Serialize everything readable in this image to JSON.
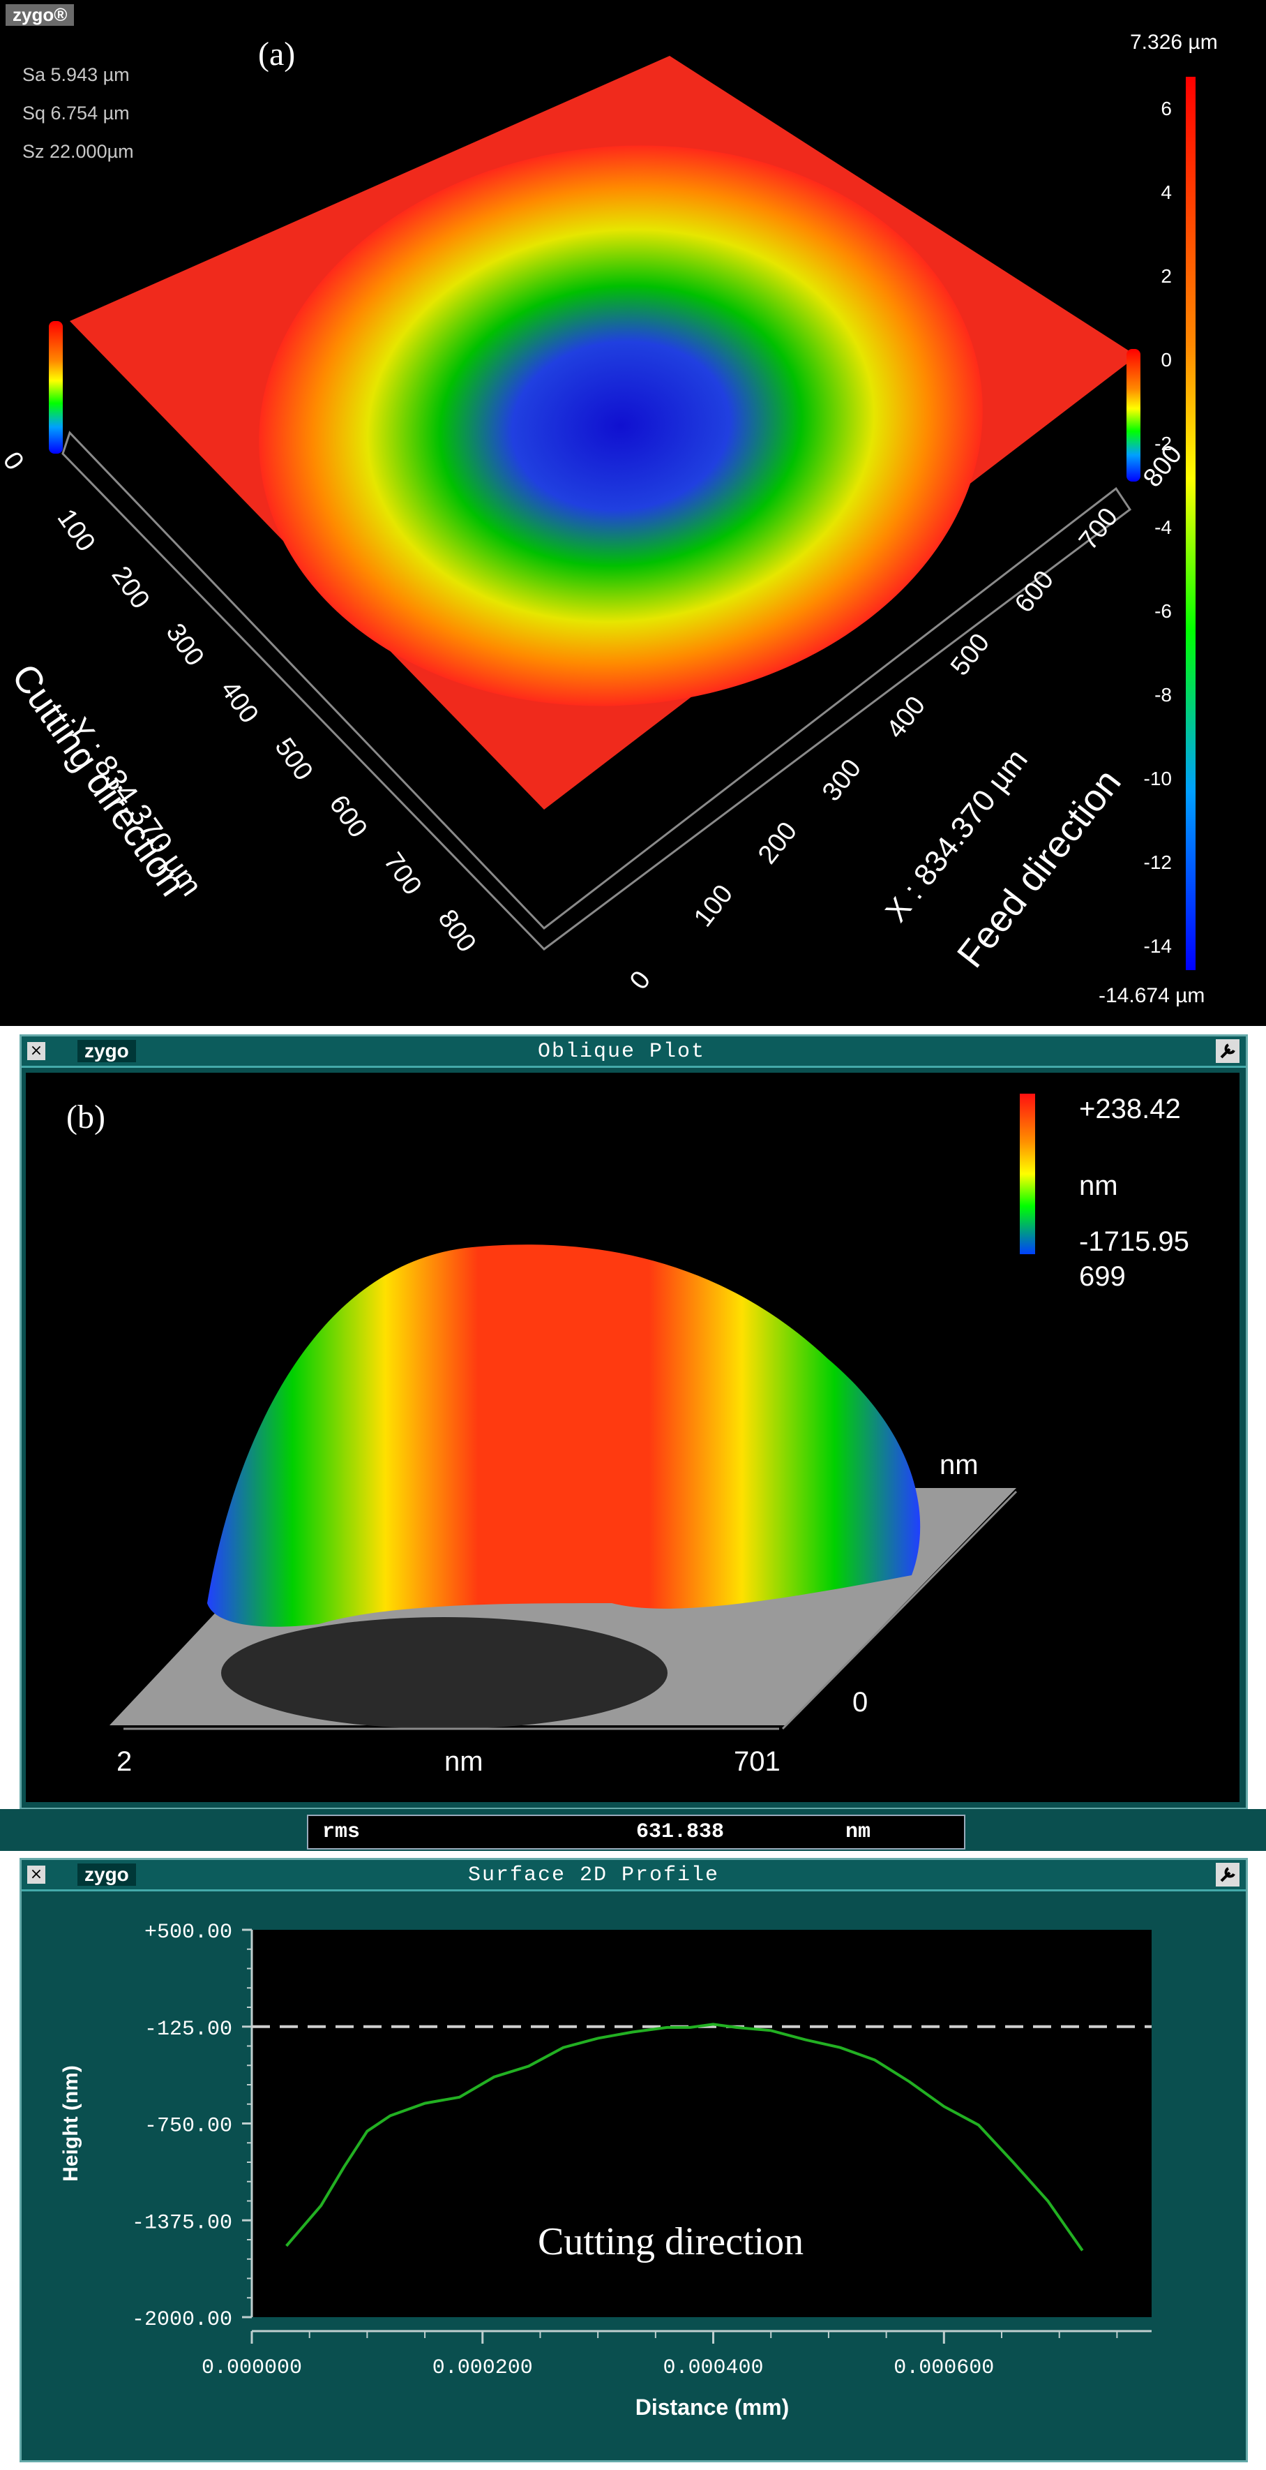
{
  "panel_a": {
    "brand": "zygo®",
    "label": "(a)",
    "stats": [
      "Sa 5.943   µm",
      "Sq 6.754   µm",
      "Sz 22.000µm"
    ],
    "colorbar": {
      "max_label": "7.326   µm",
      "min_label": "-14.674   µm",
      "ticks": [
        "6",
        "4",
        "2",
        "0",
        "-2",
        "-4",
        "-6",
        "-8",
        "-10",
        "-12",
        "-14"
      ]
    },
    "y_axis": {
      "ticks": [
        "0",
        "100",
        "200",
        "300",
        "400",
        "500",
        "600",
        "700",
        "800"
      ],
      "label": "Y : 834.370 µm",
      "direction": "Cutting direction"
    },
    "x_axis": {
      "ticks": [
        "0",
        "100",
        "200",
        "300",
        "400",
        "500",
        "600",
        "700",
        "800"
      ],
      "label": "X : 834.370 µm",
      "direction": "Feed direction"
    }
  },
  "panel_b": {
    "title": "Oblique Plot",
    "brand": "zygo",
    "label": "(b)",
    "colorbar": {
      "max": "+238.42",
      "unit": "nm",
      "min": "-1715.95",
      "extra": "699"
    },
    "x_axis": {
      "start": "2",
      "unit": "nm",
      "end": "701"
    },
    "depth_axis": {
      "unit": "nm",
      "zero": "0"
    },
    "rms": {
      "label": "rms",
      "value": "631.838",
      "unit": "nm"
    }
  },
  "panel_c": {
    "title": "Surface 2D Profile",
    "brand": "zygo",
    "annotation": "Cutting direction"
  },
  "chart_data": {
    "type": "line",
    "title": "",
    "xlabel": "Distance (mm)",
    "ylabel": "Height (nm)",
    "xlim": [
      0.0,
      0.00078
    ],
    "ylim": [
      -2000,
      500
    ],
    "xticks": [
      "0.000000",
      "0.000200",
      "0.000400",
      "0.000600"
    ],
    "xtick_values": [
      0.0,
      0.0002,
      0.0004,
      0.0006
    ],
    "yticks": [
      "+500.00",
      "-125.00",
      "-750.00",
      "-1375.00",
      "-2000.00"
    ],
    "ytick_values": [
      500,
      -125,
      -750,
      -1375,
      -2000
    ],
    "reference_line": -125,
    "series": [
      {
        "color": "#22b022",
        "x": [
          3e-05,
          6e-05,
          8e-05,
          0.0001,
          0.00012,
          0.00015,
          0.00018,
          0.00021,
          0.00024,
          0.00027,
          0.0003,
          0.00033,
          0.00036,
          0.00038,
          0.0004,
          0.00042,
          0.00045,
          0.00048,
          0.00051,
          0.00054,
          0.00057,
          0.0006,
          0.00063,
          0.00066,
          0.00069,
          0.00072
        ],
        "y": [
          -1540,
          -1280,
          -1030,
          -800,
          -700,
          -620,
          -580,
          -450,
          -380,
          -260,
          -200,
          -160,
          -130,
          -130,
          -110,
          -130,
          -150,
          -210,
          -260,
          -340,
          -480,
          -640,
          -760,
          -1000,
          -1250,
          -1570
        ]
      }
    ]
  },
  "colors": {
    "surface_high": "#ff2020",
    "surface_mid": "#00c000",
    "surface_low": "#1010d0",
    "window_bg": "#0a4f4f",
    "profile_line": "#22b022"
  }
}
